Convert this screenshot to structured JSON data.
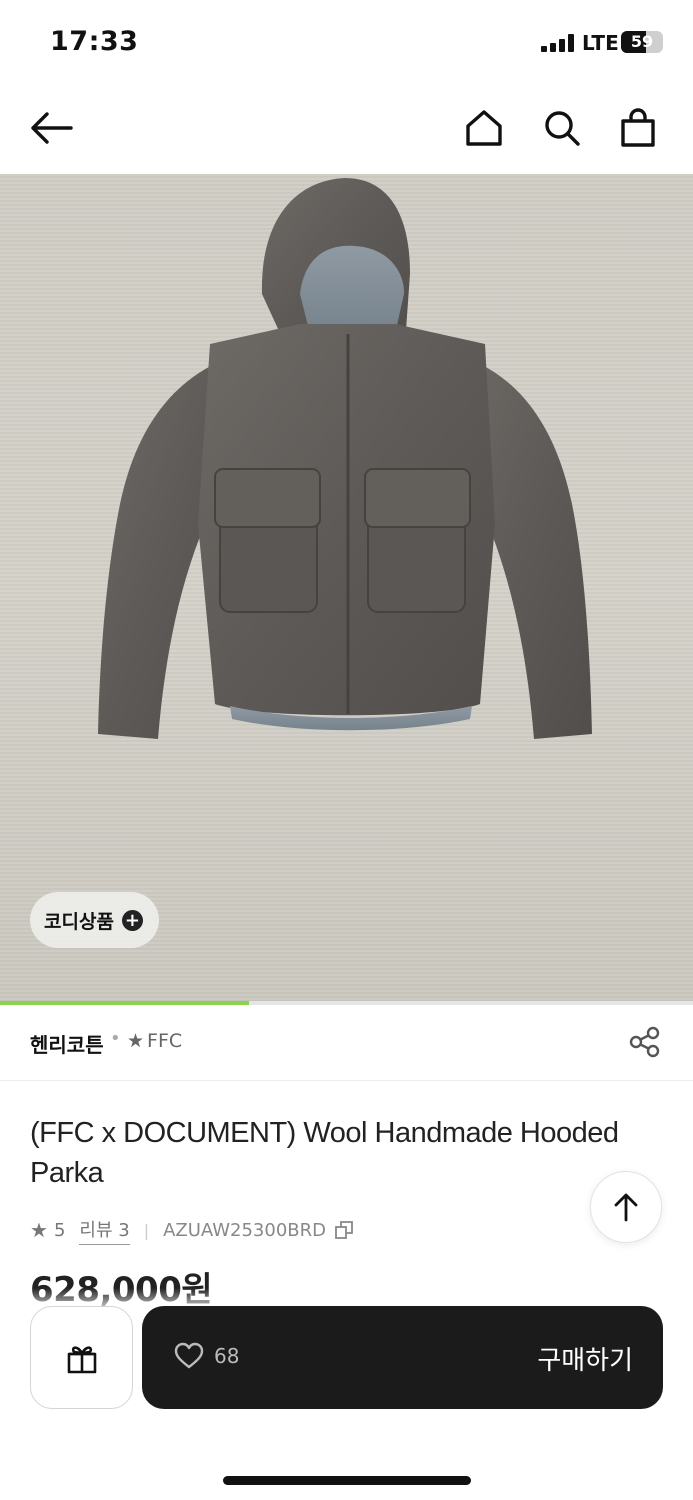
{
  "status_bar": {
    "time": "17:33",
    "network": "LTE",
    "battery_level": "59"
  },
  "nav": {
    "back_icon": "arrow-left-icon",
    "home_icon": "home-icon",
    "search_icon": "search-icon",
    "cart_icon": "shopping-bag-icon"
  },
  "gallery": {
    "coordi_label": "코디상품",
    "coordi_icon": "plus-circle-icon",
    "progress_fraction": 0.36
  },
  "brand": {
    "name": "헨리코튼",
    "separator": "•",
    "star": "★",
    "tag": "FFC",
    "share_icon": "share-icon"
  },
  "product": {
    "title": "(FFC x DOCUMENT) Wool Handmade Hooded Parka",
    "rating": "5",
    "review_label": "리뷰 3",
    "divider": "|",
    "code": "AZUAW25300BRD",
    "price": "628,000원"
  },
  "actions": {
    "gift_icon": "gift-icon",
    "like_count": "68",
    "buy_label": "구매하기",
    "scroll_top_icon": "arrow-up-icon"
  },
  "colors": {
    "progress": "#8bd14b",
    "buy_bar": "#1b1b1b"
  }
}
